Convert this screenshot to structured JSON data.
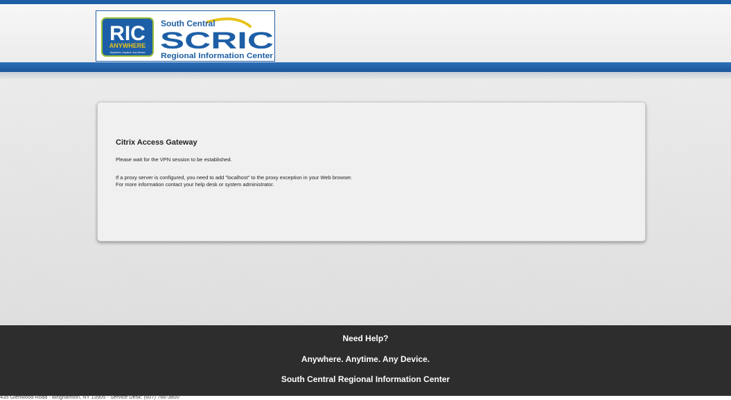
{
  "logo": {
    "ric_text": "RIC",
    "anywhere_text": "ANYWHERE",
    "tagline": "Anywhere. Anytime. Any Device",
    "south_central": "South Central",
    "scric_text": "SCRIC",
    "regional": "Regional Information Center"
  },
  "dialog": {
    "title": "Citrix Access Gateway",
    "wait_message": "Please wait for the VPN session to be established.",
    "proxy_message": "If a proxy server is configured, you need to add \"localhost\" to the proxy exception in your Web browser.",
    "help_message": "For more information contact your help desk or system administrator."
  },
  "footer": {
    "help_link": "Need Help?",
    "slogan": "Anywhere. Anytime. Any Device.",
    "org_name": "South Central Regional Information Center",
    "address": "435 Glenwood Road - Binghamton, NY 13905 - Service Desk: (607) 766-3800"
  },
  "colors": {
    "brand_blue": "#1d5fa6",
    "logo_green": "#9cc03a",
    "logo_yellow": "#e8c21c",
    "footer_bg": "#2d2d2d"
  }
}
